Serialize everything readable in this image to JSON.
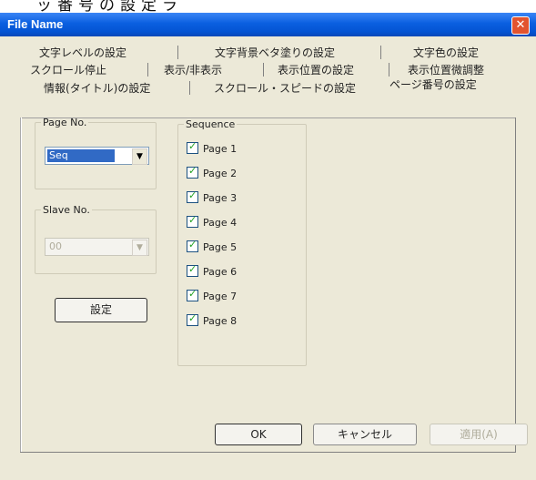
{
  "caption_text": "ッ番号の設定ラ",
  "window": {
    "title": "File Name"
  },
  "tabs": {
    "row1": [
      "文字レベルの設定",
      "文字背景ベタ塗りの設定",
      "文字色の設定"
    ],
    "row2": [
      "スクロール停止",
      "表示/非表示",
      "表示位置の設定",
      "表示位置微調整"
    ],
    "row3": [
      "情報(タイトル)の設定",
      "スクロール・スピードの設定",
      "ページ番号の設定"
    ],
    "selected": "ページ番号の設定"
  },
  "page_no": {
    "label": "Page No.",
    "value": "Seq"
  },
  "slave_no": {
    "label": "Slave No.",
    "value": "00"
  },
  "set_button": "設定",
  "sequence": {
    "label": "Sequence",
    "items": [
      {
        "label": "Page 1",
        "checked": true
      },
      {
        "label": "Page 2",
        "checked": true
      },
      {
        "label": "Page 3",
        "checked": true
      },
      {
        "label": "Page 4",
        "checked": true
      },
      {
        "label": "Page 5",
        "checked": true
      },
      {
        "label": "Page 6",
        "checked": true
      },
      {
        "label": "Page 7",
        "checked": true
      },
      {
        "label": "Page 8",
        "checked": true
      }
    ]
  },
  "footer": {
    "ok": "OK",
    "cancel": "キャンセル",
    "apply": "適用(A)"
  }
}
